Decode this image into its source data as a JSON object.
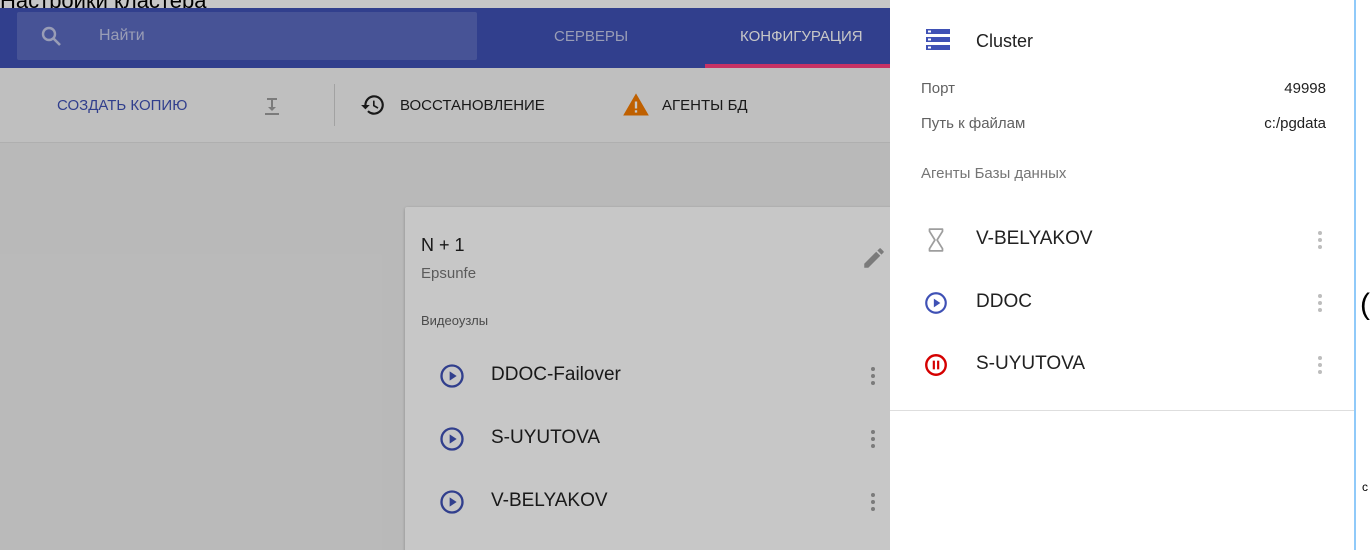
{
  "top_cut_text": "Настройки кластера",
  "navbar": {
    "search_placeholder": "Найти",
    "tabs": [
      {
        "label": "СЕРВЕРЫ",
        "active": false
      },
      {
        "label": "КОНФИГУРАЦИЯ",
        "active": true
      }
    ]
  },
  "toolbar": {
    "copy_label": "СОЗДАТЬ КОПИЮ",
    "download_icon": "download-icon",
    "restore_label": "ВОССТАНОВЛЕНИЕ",
    "restore_icon": "history-icon",
    "agents_label": "АГЕНТЫ БД",
    "agents_icon": "warning-icon"
  },
  "card": {
    "title": "N + 1",
    "subtitle": "Epsunfe",
    "section_label": "Видеоузлы",
    "nodes": [
      {
        "label": "DDOC-Failover",
        "icon": "play-circle-icon"
      },
      {
        "label": "S-UYUTOVA",
        "icon": "play-circle-icon"
      },
      {
        "label": "V-BELYAKOV",
        "icon": "play-circle-icon"
      }
    ]
  },
  "panel": {
    "title": "Cluster",
    "icon": "storage-icon",
    "properties": [
      {
        "key": "Порт",
        "value": "49998"
      },
      {
        "key": "Путь к файлам",
        "value": "c:/pgdata"
      }
    ],
    "agents_header": "Агенты Базы данных",
    "agents": [
      {
        "label": "V-BELYAKOV",
        "status": "pending",
        "icon": "hourglass-icon"
      },
      {
        "label": "DDOC",
        "status": "running",
        "icon": "play-circle-icon"
      },
      {
        "label": "S-UYUTOVA",
        "status": "paused",
        "icon": "pause-circle-icon"
      }
    ]
  },
  "colors": {
    "navbar": "#3f51b5",
    "accent": "#ff4081",
    "running": "#3f51b5",
    "paused": "#d50000",
    "warning": "#f57c00"
  },
  "edge": {
    "glyph": "(",
    "small": "c"
  }
}
